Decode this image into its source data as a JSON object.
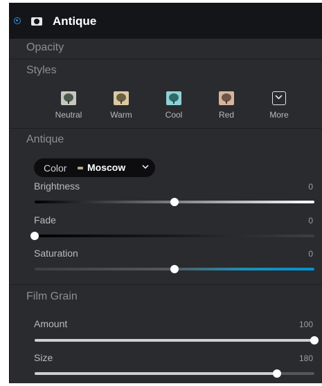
{
  "header": {
    "title": "Antique"
  },
  "opacity": {
    "title": "Opacity"
  },
  "styles": {
    "title": "Styles",
    "presets": [
      {
        "label": "Neutral"
      },
      {
        "label": "Warm"
      },
      {
        "label": "Cool"
      },
      {
        "label": "Red"
      },
      {
        "label": "More"
      }
    ]
  },
  "antique": {
    "title": "Antique",
    "color_label": "Color",
    "color_value": "Moscow",
    "brightness": {
      "label": "Brightness",
      "value": "0",
      "level": 0.5
    },
    "fade": {
      "label": "Fade",
      "value": "0",
      "level": 0.0
    },
    "saturation": {
      "label": "Saturation",
      "value": "0",
      "level": 0.5
    }
  },
  "film_grain": {
    "title": "Film Grain",
    "amount": {
      "label": "Amount",
      "value": "100",
      "level": 1.0
    },
    "size": {
      "label": "Size",
      "value": "180",
      "level": 0.866
    }
  },
  "colors": {
    "accent": "#2f8fe6",
    "panel_bg": "#2a2b2e",
    "header_bg": "#141518",
    "saturation_blue": "#0092d4"
  },
  "icons": [
    "radio-selected-icon",
    "camera-filter-icon",
    "chevron-down-icon",
    "more-chevron-icon"
  ]
}
